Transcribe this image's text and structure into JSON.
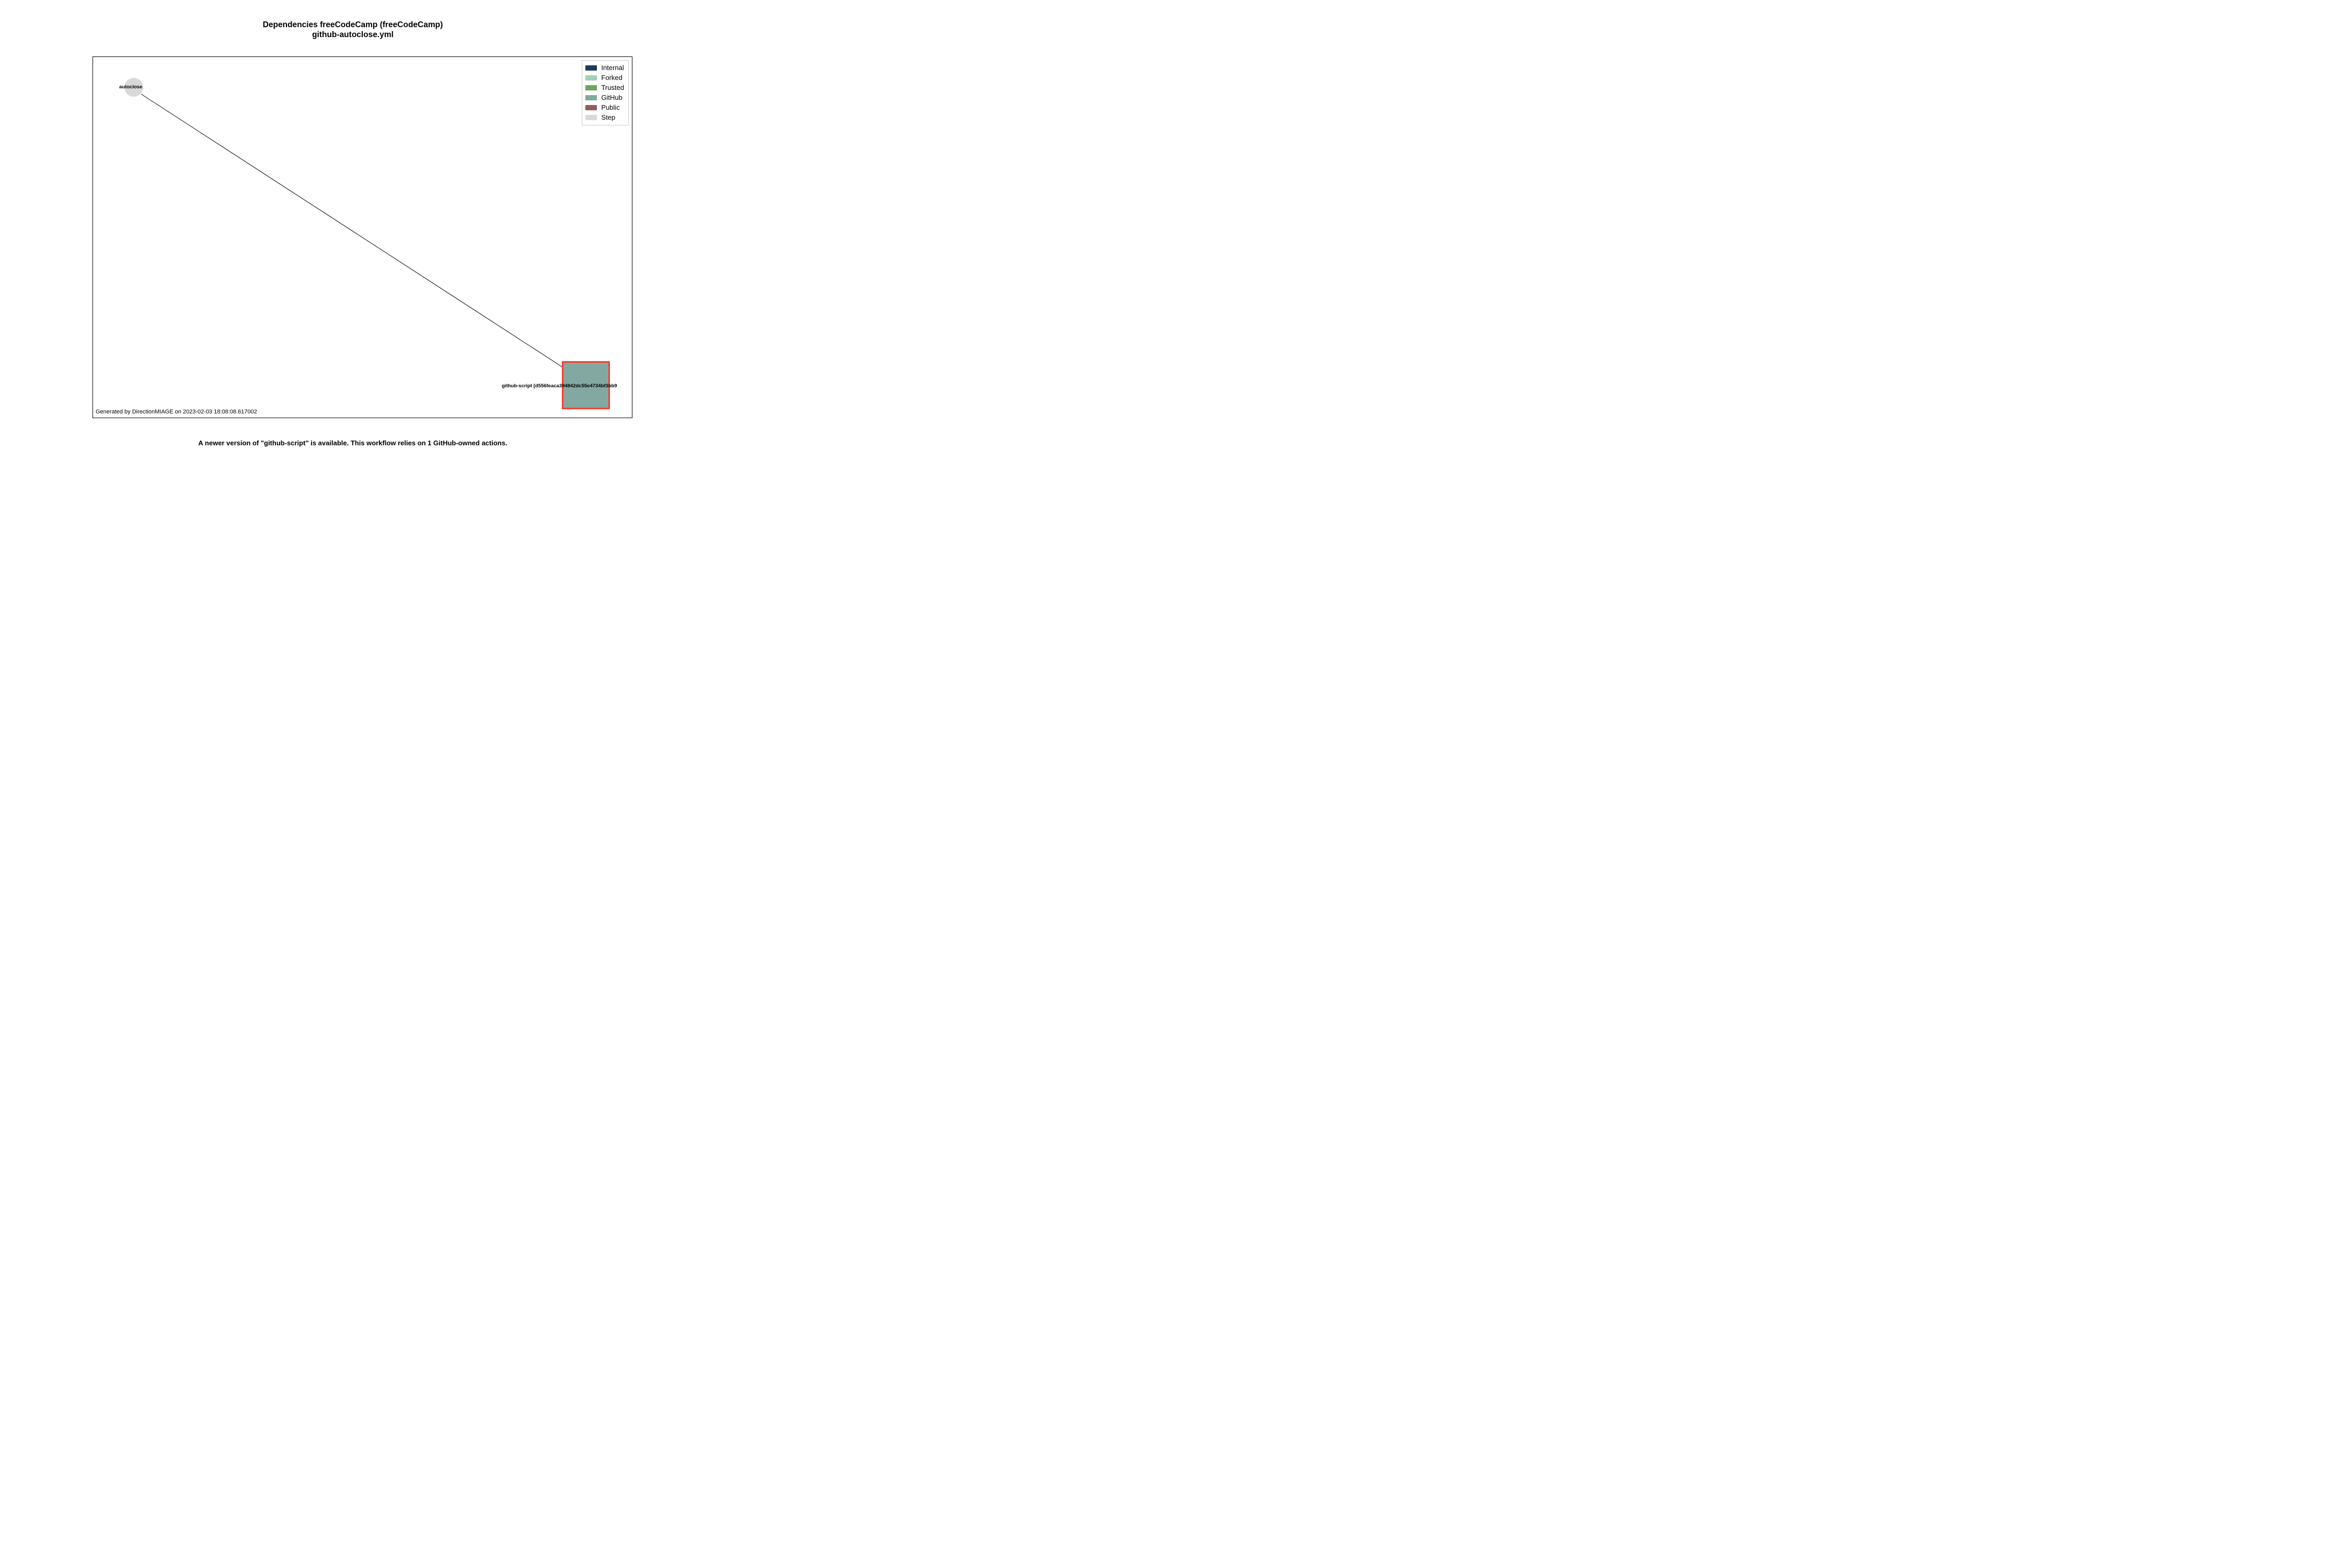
{
  "title": {
    "line1": "Dependencies freeCodeCamp (freeCodeCamp)",
    "line2": "github-autoclose.yml"
  },
  "legend": {
    "items": [
      {
        "label": "Internal",
        "color": "#1f3b5b"
      },
      {
        "label": "Forked",
        "color": "#9bd4b4"
      },
      {
        "label": "Trusted",
        "color": "#6aa75a"
      },
      {
        "label": "GitHub",
        "color": "#82a8a1"
      },
      {
        "label": "Public",
        "color": "#9a5a5a"
      },
      {
        "label": "Step",
        "color": "#d9d9d9"
      }
    ]
  },
  "nodes": {
    "step": {
      "label": "autoclose"
    },
    "github_action": {
      "label": "github-script [d556feaca394842dc55e4734bf3bb9"
    }
  },
  "footer_in_plot": "Generated by DirectionMIAGE on 2023-02-03 18:08:08.617002",
  "caption": "A newer version of \"github-script\" is available. This workflow relies on 1 GitHub-owned actions.",
  "chart_data": {
    "type": "graph",
    "description": "Dependency graph of a GitHub Actions workflow file",
    "nodes": [
      {
        "id": "autoclose",
        "kind": "Step",
        "shape": "circle",
        "highlighted": false
      },
      {
        "id": "github-script",
        "kind": "GitHub",
        "shape": "square",
        "highlighted": true,
        "ref": "d556feaca394842dc55e4734bf3bb9"
      }
    ],
    "edges": [
      {
        "from": "autoclose",
        "to": "github-script",
        "directed": true
      }
    ]
  }
}
